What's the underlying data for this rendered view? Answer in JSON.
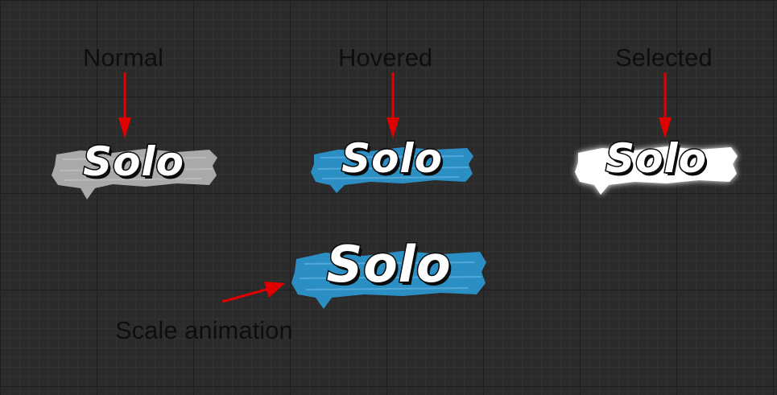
{
  "labels": {
    "normal": "Normal",
    "hovered": "Hovered",
    "selected": "Selected",
    "scale_animation": "Scale animation"
  },
  "buttons": {
    "normal": {
      "text": "Solo",
      "brush_color": "#a9a9a9"
    },
    "hovered": {
      "text": "Solo",
      "brush_color": "#2c8fc4"
    },
    "selected": {
      "text": "Solo",
      "brush_color": "#ffffff"
    },
    "scaled": {
      "text": "Solo",
      "brush_color": "#2c8fc4"
    }
  },
  "colors": {
    "arrow": "#e00000",
    "label_text": "#0e0e0e",
    "grid_background": "#2b2b2b"
  }
}
